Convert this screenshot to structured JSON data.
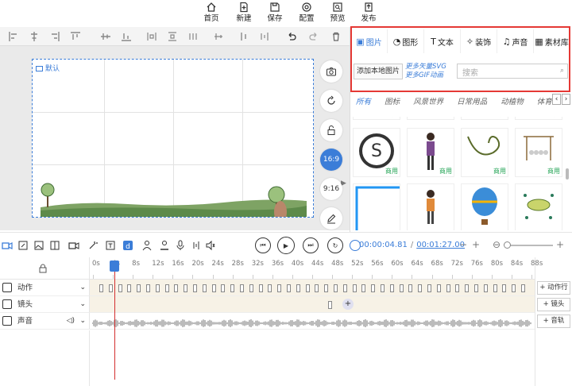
{
  "topbar": {
    "items": [
      {
        "label": "首页",
        "icon": "home-icon"
      },
      {
        "label": "新建",
        "icon": "new-file-icon"
      },
      {
        "label": "保存",
        "icon": "save-icon"
      },
      {
        "label": "配置",
        "icon": "settings-icon"
      },
      {
        "label": "预览",
        "icon": "preview-icon"
      },
      {
        "label": "发布",
        "icon": "publish-icon"
      }
    ]
  },
  "canvas": {
    "scene_label": "默认"
  },
  "side_tools": {
    "ratio_169": "16:9",
    "ratio_916": "9:16"
  },
  "panel": {
    "tabs": [
      {
        "label": "图片",
        "glyph": "▣"
      },
      {
        "label": "图形",
        "glyph": "◔"
      },
      {
        "label": "文本",
        "glyph": "T"
      },
      {
        "label": "装饰",
        "glyph": "✧"
      },
      {
        "label": "声音",
        "glyph": "♫"
      },
      {
        "label": "素材库",
        "glyph": "▦"
      }
    ],
    "add_local": "添加本地图片",
    "more_svg": "更多矢量SVG",
    "more_gif": "更多GIF动画",
    "search_placeholder": "搜索",
    "categories": [
      "所有",
      "图标",
      "风景世界",
      "日常用品",
      "动植物",
      "体育"
    ],
    "commercial_tag": "商用"
  },
  "playbar": {
    "current_time": "00:00:04.81",
    "total_time": "00:01:27.00",
    "separator": "/"
  },
  "timeline": {
    "ticks": [
      "0s",
      "4s",
      "8s",
      "12s",
      "16s",
      "20s",
      "24s",
      "28s",
      "32s",
      "36s",
      "40s",
      "44s",
      "48s",
      "52s",
      "56s",
      "60s",
      "64s",
      "68s",
      "72s",
      "76s",
      "80s",
      "84s",
      "88s"
    ],
    "tracks": [
      {
        "label": "动作",
        "add": "+ 动作行"
      },
      {
        "label": "镜头",
        "add": "+ 镜头"
      },
      {
        "label": "声音",
        "add": "+ 音轨"
      }
    ]
  },
  "colors": {
    "accent": "#3b7dd8",
    "highlight_box": "#e53935",
    "commercial": "#22a354",
    "playhead": "#d32f2f"
  }
}
